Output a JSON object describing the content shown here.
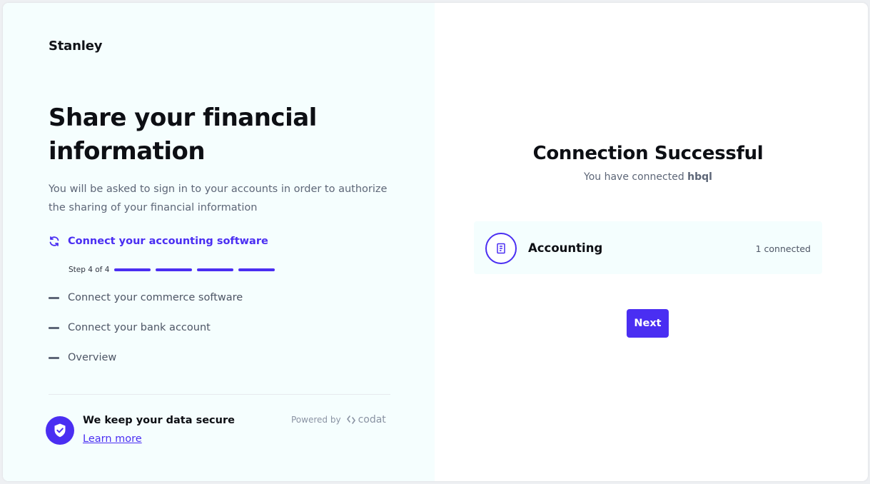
{
  "brand": {
    "name": "Stanley"
  },
  "left": {
    "headline": "Share your financial information",
    "intro": "You will be asked to sign in to your accounts in order to authorize the sharing of your financial information",
    "active_step": {
      "label": "Connect your accounting software",
      "icon": "sync-icon",
      "progress_text": "Step 4 of 4",
      "segments": 4
    },
    "steps": [
      {
        "label": "Connect your commerce software"
      },
      {
        "label": "Connect your bank account"
      },
      {
        "label": "Overview"
      }
    ],
    "footer": {
      "secure_title": "We keep your data secure",
      "learn_more": "Learn more",
      "powered_by": "Powered by",
      "powered_brand": "codat"
    }
  },
  "right": {
    "title": "Connection Successful",
    "subtitle_prefix": "You have connected",
    "connected_name": "hbql",
    "connection": {
      "label": "Accounting",
      "count": "1 connected",
      "icon": "document-icon"
    },
    "next_label": "Next"
  },
  "colors": {
    "accent": "#4a2ef2",
    "left_panel_bg": "#f5fefe",
    "text_dark": "#0d0f14",
    "text_muted": "#5d6677"
  }
}
